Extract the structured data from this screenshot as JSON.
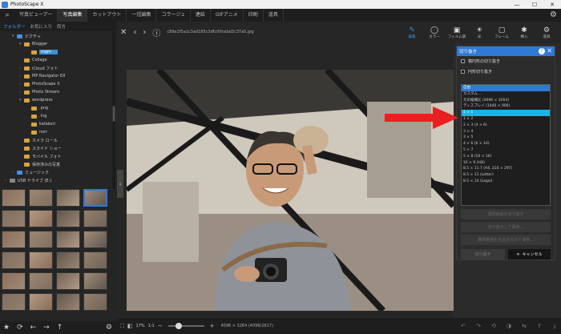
{
  "app": {
    "title": "PhotoScape X"
  },
  "window": {
    "minimize": "—",
    "maximize": "☐",
    "close": "✕"
  },
  "tabs": [
    "写真ビューアー",
    "写真編集",
    "カットアウト",
    "一括編集",
    "コラージュ",
    "連結",
    "GIFアニメ",
    "印刷",
    "道具"
  ],
  "folder_tabs": [
    "フォルダー",
    "お気に入り",
    "両方"
  ],
  "tree": [
    {
      "label": "ピクチャ",
      "indent": 1,
      "kind": "blue",
      "arrow": "▾"
    },
    {
      "label": "Blogger",
      "indent": 2,
      "kind": "folder",
      "arrow": "▾"
    },
    {
      "label": "mgm",
      "indent": 3,
      "kind": "folder",
      "arrow": "",
      "selected": true
    },
    {
      "label": "Collage",
      "indent": 2,
      "kind": "folder",
      "arrow": ""
    },
    {
      "label": "iCloud フォト",
      "indent": 2,
      "kind": "folder",
      "arrow": "›"
    },
    {
      "label": "MP Navigator EX",
      "indent": 2,
      "kind": "folder",
      "arrow": "›"
    },
    {
      "label": "PhotoScape X",
      "indent": 2,
      "kind": "folder",
      "arrow": "›"
    },
    {
      "label": "Photo Stream",
      "indent": 2,
      "kind": "folder",
      "arrow": "›"
    },
    {
      "label": "wordpress",
      "indent": 2,
      "kind": "folder",
      "arrow": "▾"
    },
    {
      "label": ".png",
      "indent": 3,
      "kind": "folder",
      "arrow": ""
    },
    {
      "label": ".ing",
      "indent": 3,
      "kind": "folder",
      "arrow": ""
    },
    {
      "label": "kafakori",
      "indent": 3,
      "kind": "folder",
      "arrow": ""
    },
    {
      "label": "nori",
      "indent": 3,
      "kind": "folder",
      "arrow": ""
    },
    {
      "label": "カメラ ロール",
      "indent": 2,
      "kind": "folder",
      "arrow": ""
    },
    {
      "label": "スライド ショー",
      "indent": 2,
      "kind": "folder",
      "arrow": ""
    },
    {
      "label": "モバイル フォト",
      "indent": 2,
      "kind": "folder",
      "arrow": ""
    },
    {
      "label": "保存済みの写真",
      "indent": 2,
      "kind": "folder",
      "arrow": ""
    },
    {
      "label": "ミュージック",
      "indent": 1,
      "kind": "blue",
      "arrow": "›"
    },
    {
      "label": "USB ドライブ (E:)",
      "indent": 0,
      "kind": "gray",
      "arrow": "›"
    }
  ],
  "nav": {
    "close": "✕",
    "prev": "‹",
    "next": "›",
    "info": "ⓘ",
    "filename": "c89a1f5a1c3ad185c3dfc00cebd2c37a5.jpg"
  },
  "toolbar": [
    {
      "label": "編集",
      "icon": "✎",
      "active": true
    },
    {
      "label": "カラー",
      "icon": "◯"
    },
    {
      "label": "フィルム調",
      "icon": "▣"
    },
    {
      "label": "光",
      "icon": "☀"
    },
    {
      "label": "フレーム",
      "icon": "▢"
    },
    {
      "label": "挿入",
      "icon": "✱"
    },
    {
      "label": "道具",
      "icon": "⚙"
    }
  ],
  "crop": {
    "title": "切り抜き",
    "help": "?",
    "close": "✕",
    "opt_outer": "楕円形の切り抜き",
    "opt_circle": "円形切り抜き",
    "ratios": [
      "自由",
      "カスタム...",
      "元の縦横比 (4096 × 3264)",
      "ディスプレイ (1440 × 900)",
      "1 × 1",
      "1 × 2",
      "2 × 3 (4 × 6)",
      "3 × 4",
      "3 × 5",
      "4 × 6 (6 × 10)",
      "5 × 7",
      "5 × 8 (10 × 16)",
      "16 × 9 (HD)",
      "8.5 × 11.7 (A4, 210 × 297)",
      "8.5 × 11 (Letter)",
      "8.5 × 14 (Legal)"
    ],
    "highlight_index": 0,
    "selected_index": 4,
    "btn_apply": "選択範囲を切り抜き",
    "btn_save": "切り抜きして保存...",
    "btn_save_as": "選択範囲を名前を付けて保存...",
    "ok": "切り抜き",
    "cancel": "キャンセル",
    "cancel_icon": "✕"
  },
  "status": {
    "zoom": "17%",
    "fit": "1:1",
    "minus": "−",
    "plus": "+",
    "size": "4096 × 3264 (4096/2817)"
  },
  "colors": {
    "accent": "#2f7ad6",
    "selected": "#17b4ee",
    "arrow": "#e82020"
  }
}
